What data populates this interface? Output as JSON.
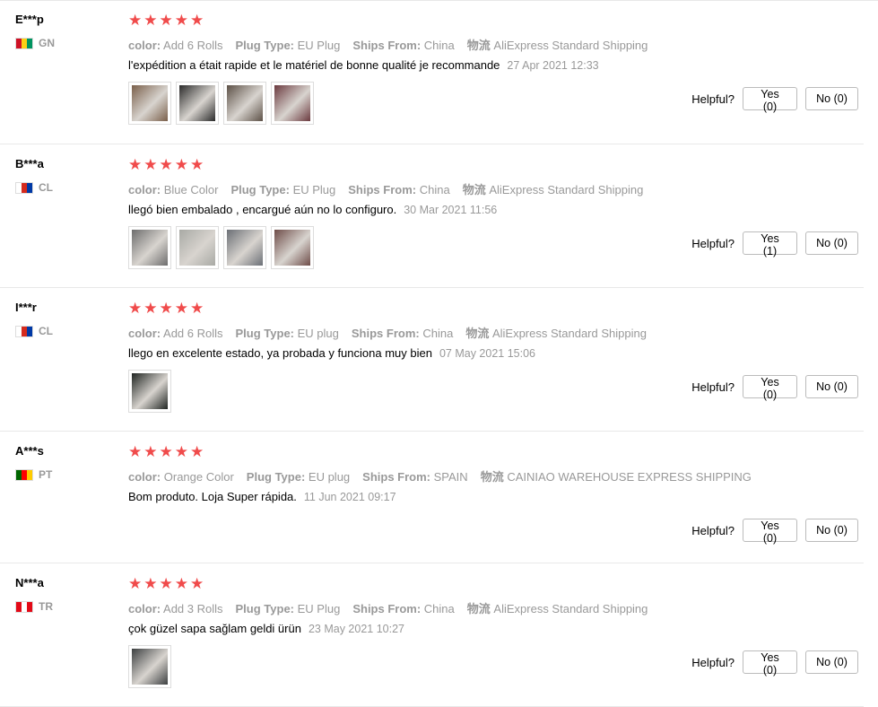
{
  "helpful_label": "Helpful?",
  "reviews": [
    {
      "user": "E***p",
      "country": "GN",
      "flag_colors": [
        "#ce1126",
        "#fcd116",
        "#009460"
      ],
      "stars": 5,
      "attrs": [
        {
          "label": "color:",
          "value": "Add 6 Rolls"
        },
        {
          "label": "Plug Type:",
          "value": "EU Plug"
        },
        {
          "label": "Ships From:",
          "value": "China"
        },
        {
          "label": "物流",
          "value": "AliExpress Standard Shipping"
        }
      ],
      "text": "l'expédition a était rapide et le matériel de bonne qualité je recommande",
      "date": "27 Apr 2021 12:33",
      "thumbs": 4,
      "yes": "Yes (0)",
      "no": "No (0)"
    },
    {
      "user": "B***a",
      "country": "CL",
      "flag_colors": [
        "#ffffff",
        "#d52b1e",
        "#0039a6"
      ],
      "stars": 5,
      "attrs": [
        {
          "label": "color:",
          "value": "Blue Color"
        },
        {
          "label": "Plug Type:",
          "value": "EU Plug"
        },
        {
          "label": "Ships From:",
          "value": "China"
        },
        {
          "label": "物流",
          "value": "AliExpress Standard Shipping"
        }
      ],
      "text": "llegó bien embalado , encargué aún no lo configuro.",
      "date": "30 Mar 2021 11:56",
      "thumbs": 4,
      "yes": "Yes (1)",
      "no": "No (0)"
    },
    {
      "user": "I***r",
      "country": "CL",
      "flag_colors": [
        "#ffffff",
        "#d52b1e",
        "#0039a6"
      ],
      "stars": 5,
      "attrs": [
        {
          "label": "color:",
          "value": "Add 6 Rolls"
        },
        {
          "label": "Plug Type:",
          "value": "EU plug"
        },
        {
          "label": "Ships From:",
          "value": "China"
        },
        {
          "label": "物流",
          "value": "AliExpress Standard Shipping"
        }
      ],
      "text": "llego en excelente estado, ya probada y funciona muy bien",
      "date": "07 May 2021 15:06",
      "thumbs": 1,
      "yes": "Yes (0)",
      "no": "No (0)"
    },
    {
      "user": "A***s",
      "country": "PT",
      "flag_colors": [
        "#006600",
        "#ff0000",
        "#ffcc00"
      ],
      "stars": 5,
      "attrs": [
        {
          "label": "color:",
          "value": "Orange Color"
        },
        {
          "label": "Plug Type:",
          "value": "EU plug"
        },
        {
          "label": "Ships From:",
          "value": "SPAIN"
        },
        {
          "label": "物流",
          "value": "CAINIAO WAREHOUSE EXPRESS SHIPPING"
        }
      ],
      "text": "Bom produto. Loja Super rápida.",
      "date": "11 Jun 2021 09:17",
      "thumbs": 0,
      "yes": "Yes (0)",
      "no": "No (0)"
    },
    {
      "user": "N***a",
      "country": "TR",
      "flag_colors": [
        "#e30a17",
        "#ffffff",
        "#e30a17"
      ],
      "stars": 5,
      "attrs": [
        {
          "label": "color:",
          "value": "Add 3 Rolls"
        },
        {
          "label": "Plug Type:",
          "value": "EU Plug"
        },
        {
          "label": "Ships From:",
          "value": "China"
        },
        {
          "label": "物流",
          "value": "AliExpress Standard Shipping"
        }
      ],
      "text": "çok güzel sapa sağlam geldi ürün",
      "date": "23 May 2021 10:27",
      "thumbs": 1,
      "yes": "Yes (0)",
      "no": "No (0)"
    }
  ]
}
